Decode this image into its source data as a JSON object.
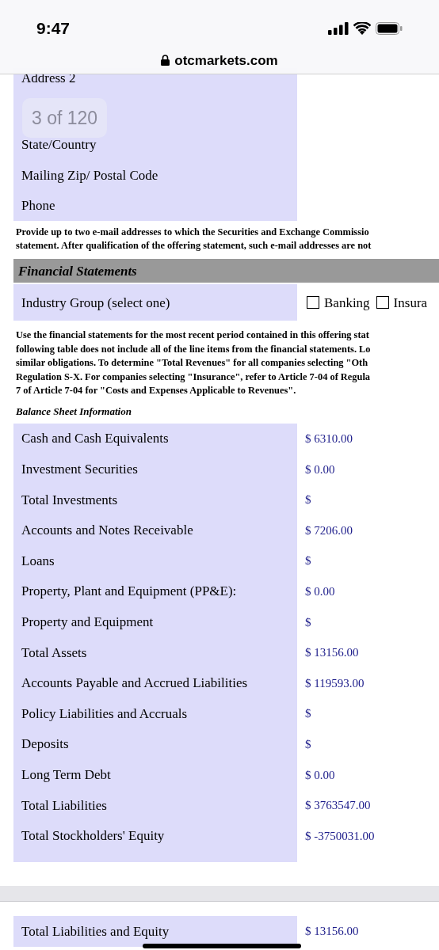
{
  "status_bar": {
    "time": "9:47"
  },
  "url_bar": {
    "domain": "otcmarkets.com"
  },
  "find_overlay": {
    "text": "3 of 120"
  },
  "contact_rows": [
    {
      "label": "Address 2"
    },
    {},
    {
      "label": "State/Country"
    },
    {
      "label": "Mailing Zip/ Postal Code"
    },
    {
      "label": "Phone"
    }
  ],
  "email_note": [
    "Provide up to two e-mail addresses to which the Securities and Exchange Commissio",
    "statement. After qualification of the offering statement, such e-mail addresses are not"
  ],
  "section_header": "Financial Statements",
  "industry": {
    "label": "Industry Group (select one)",
    "options": [
      {
        "label": "Banking",
        "checked": false
      },
      {
        "label": "Insura",
        "checked": false
      }
    ]
  },
  "instructions": [
    "Use the financial statements for the most recent period contained in this offering stat",
    "following table does not include all of the line items from the financial statements. Lo",
    "similar obligations. To determine \"Total Revenues\" for all companies selecting \"Oth",
    "Regulation S-X. For companies selecting \"Insurance\", refer to Article 7-04 of Regula",
    "7 of Article 7-04 for \"Costs and Expenses Applicable to Revenues\"."
  ],
  "subheading": "Balance Sheet Information",
  "balance_rows": [
    {
      "label": "Cash and Cash Equivalents",
      "value": "$ 6310.00"
    },
    {
      "label": "Investment Securities",
      "value": "$ 0.00"
    },
    {
      "label": "Total Investments",
      "value": "$"
    },
    {
      "label": "Accounts and Notes Receivable",
      "value": "$ 7206.00"
    },
    {
      "label": "Loans",
      "value": "$"
    },
    {
      "label": "Property, Plant and Equipment (PP&E):",
      "value": "$ 0.00"
    },
    {
      "label": "Property and Equipment",
      "value": "$"
    },
    {
      "label": "Total Assets",
      "value": "$ 13156.00"
    },
    {
      "label": "Accounts Payable and Accrued Liabilities",
      "value": "$ 119593.00"
    },
    {
      "label": "Policy Liabilities and Accruals",
      "value": "$"
    },
    {
      "label": "Deposits",
      "value": "$"
    },
    {
      "label": "Long Term Debt",
      "value": "$ 0.00"
    },
    {
      "label": "Total Liabilities",
      "value": "$ 3763547.00"
    },
    {
      "label": "Total Stockholders' Equity",
      "value": "$ -3750031.00"
    }
  ],
  "after_break_rows": [
    {
      "label": "Total Liabilities and Equity",
      "value": "$ 13156.00"
    }
  ]
}
